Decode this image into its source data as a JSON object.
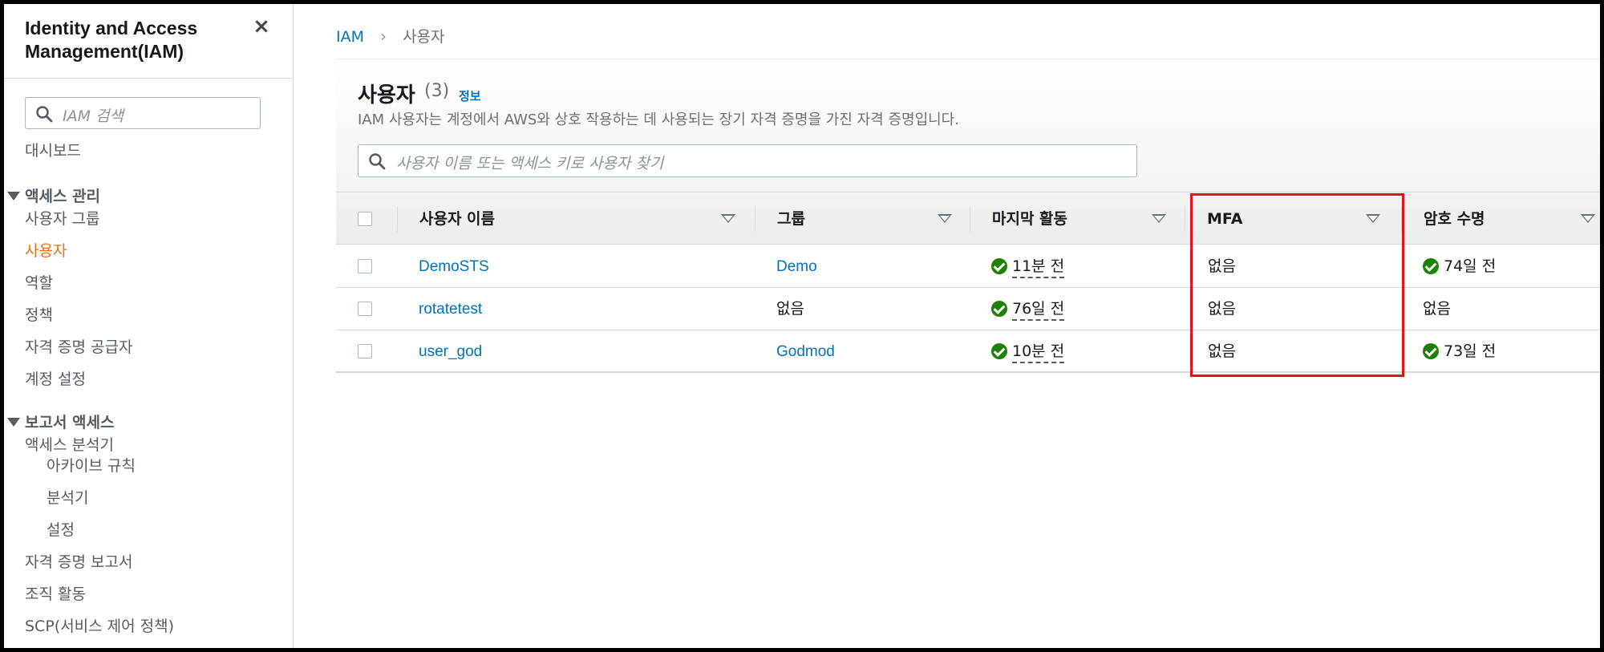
{
  "sidebar": {
    "title": "Identity and Access Management(IAM)",
    "close_icon": "×",
    "search_placeholder": "IAM 검색",
    "dashboard": "대시보드",
    "section_access_mgmt": "액세스 관리",
    "user_groups": "사용자 그룹",
    "users": "사용자",
    "roles": "역할",
    "policies": "정책",
    "identity_providers": "자격 증명 공급자",
    "account_settings": "계정 설정",
    "section_access_reports": "보고서 액세스",
    "access_analyzer": "액세스 분석기",
    "archive_rules": "아카이브 규칙",
    "analyzers": "분석기",
    "settings": "설정",
    "credential_report": "자격 증명 보고서",
    "org_activity": "조직 활동",
    "scp": "SCP(서비스 제어 정책)"
  },
  "breadcrumb": {
    "root": "IAM",
    "current": "사용자"
  },
  "panel": {
    "title": "사용자",
    "count": "(3)",
    "info_link": "정보",
    "description": "IAM 사용자는 계정에서 AWS와 상호 작용하는 데 사용되는 장기 자격 증명을 가진 자격 증명입니다.",
    "search_placeholder": "사용자 이름 또는 액세스 키로 사용자 찾기"
  },
  "table": {
    "columns": {
      "user_name": "사용자 이름",
      "groups": "그룹",
      "last_activity": "마지막 활동",
      "mfa": "MFA",
      "password_age": "암호 수명"
    },
    "rows": [
      {
        "user_name": "DemoSTS",
        "groups": "Demo",
        "last_activity": "11분 전",
        "mfa": "없음",
        "password_age": "74일 전"
      },
      {
        "user_name": "rotatetest",
        "groups": "없음",
        "last_activity": "76일 전",
        "mfa": "없음",
        "password_age": "없음"
      },
      {
        "user_name": "user_god",
        "groups": "Godmod",
        "last_activity": "10분 전",
        "mfa": "없음",
        "password_age": "73일 전"
      }
    ]
  },
  "colors": {
    "link": "#0073bb",
    "active_nav": "#ec7211",
    "success": "#1d8102",
    "highlight": "#e0131a"
  },
  "icons": {
    "search": "search-icon",
    "close": "close-icon",
    "sort": "sort-down-icon",
    "status_ok": "check-circle-icon"
  }
}
